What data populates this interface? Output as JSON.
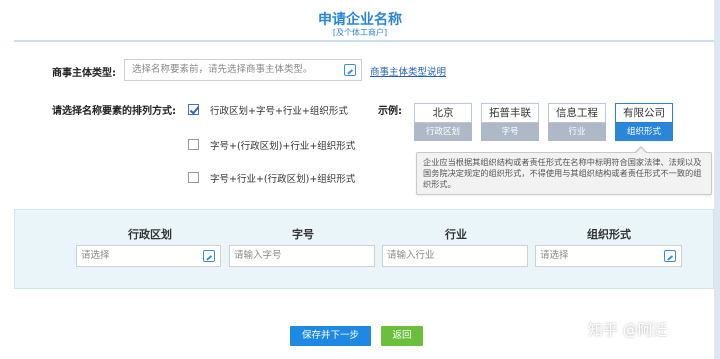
{
  "header": {
    "title": "申请企业名称",
    "subtitle": "[及个体工商户]"
  },
  "entity_type": {
    "label": "商事主体类型:",
    "placeholder": "选择名称要素前，请先选择商事主体类型。",
    "link": "商事主体类型说明"
  },
  "arrangement": {
    "label": "请选择名称要素的排列方式:",
    "options": [
      {
        "text": "行政区划+字号+行业+组织形式",
        "checked": true
      },
      {
        "text": "字号+(行政区划)+行业+组织形式",
        "checked": false
      },
      {
        "text": "字号+行业+(行政区划)+组织形式",
        "checked": false
      }
    ]
  },
  "example": {
    "label": "示例:",
    "cards": [
      {
        "top": "北京",
        "bottom": "行政区划"
      },
      {
        "top": "拓普丰联",
        "bottom": "字号"
      },
      {
        "top": "信息工程",
        "bottom": "行业"
      },
      {
        "top": "有限公司",
        "bottom": "组织形式"
      }
    ],
    "tooltip": "企业应当根据其组织结构或者责任形式在名称中标明符合国家法律、法规以及国务院决定规定的组织形式，不得使用与其组织结构或者责任形式不一致的组织形式。"
  },
  "fields": {
    "region": {
      "header": "行政区划",
      "placeholder": "请选择"
    },
    "brand": {
      "header": "字号",
      "placeholder": "请输入字号"
    },
    "industry": {
      "header": "行业",
      "placeholder": "请输入行业"
    },
    "org": {
      "header": "组织形式",
      "placeholder": "请选择"
    }
  },
  "buttons": {
    "save": "保存并下一步",
    "back": "返回"
  },
  "watermark": "知乎 @阿迁",
  "colors": {
    "accent": "#2a86d9",
    "panel_bg": "#eaf5fa",
    "save_btn": "#1e88e5",
    "back_btn": "#6cbf3d"
  }
}
